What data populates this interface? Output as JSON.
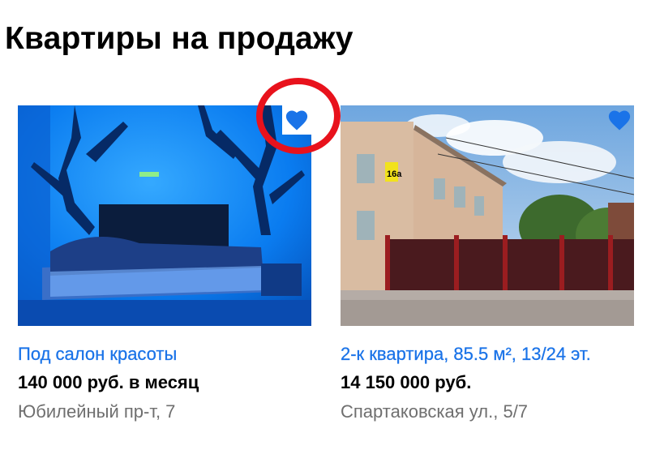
{
  "page": {
    "title": "Квартиры на продажу"
  },
  "colors": {
    "accent": "#1a73e8",
    "favorite": "#1a73e8",
    "highlight": "#e8121c",
    "muted": "#6f6f6f"
  },
  "listings": [
    {
      "title": "Под салон красоты",
      "price": "140 000 руб. в месяц",
      "address": "Юбилейный пр-т, 7",
      "favorite_icon": "heart-icon",
      "favorited": true
    },
    {
      "title": "2-к квартира, 85.5 м², 13/24 эт.",
      "price": "14 150 000 руб.",
      "address": "Спартаковская ул., 5/7",
      "favorite_icon": "heart-icon",
      "favorited": true,
      "house_sign": "16а"
    }
  ]
}
